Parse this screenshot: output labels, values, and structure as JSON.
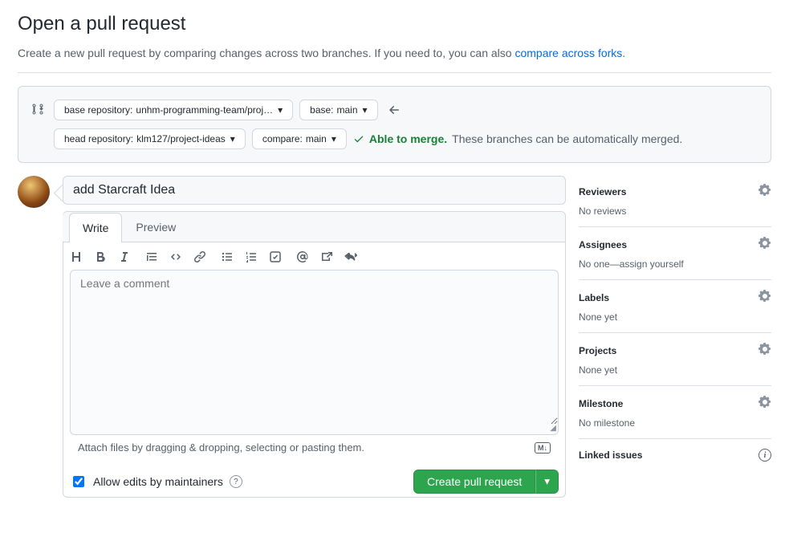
{
  "header": {
    "title": "Open a pull request",
    "subtitle_prefix": "Create a new pull request by comparing changes across two branches. If you need to, you can also ",
    "compare_link": "compare across forks",
    "subtitle_suffix": "."
  },
  "range": {
    "base_repo_label": "base repository: ",
    "base_repo_value": "unhm-programming-team/proj…",
    "base_branch_label": "base: ",
    "base_branch_value": "main",
    "head_repo_label": "head repository: ",
    "head_repo_value": "klm127/project-ideas",
    "compare_label": "compare: ",
    "compare_value": "main",
    "merge_ok": "Able to merge.",
    "merge_detail": "These branches can be automatically merged."
  },
  "form": {
    "title_value": "add Starcraft Idea",
    "tab_write": "Write",
    "tab_preview": "Preview",
    "comment_placeholder": "Leave a comment",
    "attach_hint": "Attach files by dragging & dropping, selecting or pasting them.",
    "md_label": "M↓",
    "allow_edits_label": "Allow edits by maintainers",
    "submit_label": "Create pull request"
  },
  "sidebar": {
    "reviewers": {
      "title": "Reviewers",
      "body": "No reviews"
    },
    "assignees": {
      "title": "Assignees",
      "body_prefix": "No one—",
      "assign_self": "assign yourself"
    },
    "labels": {
      "title": "Labels",
      "body": "None yet"
    },
    "projects": {
      "title": "Projects",
      "body": "None yet"
    },
    "milestone": {
      "title": "Milestone",
      "body": "No milestone"
    },
    "linked": {
      "title": "Linked issues"
    }
  }
}
